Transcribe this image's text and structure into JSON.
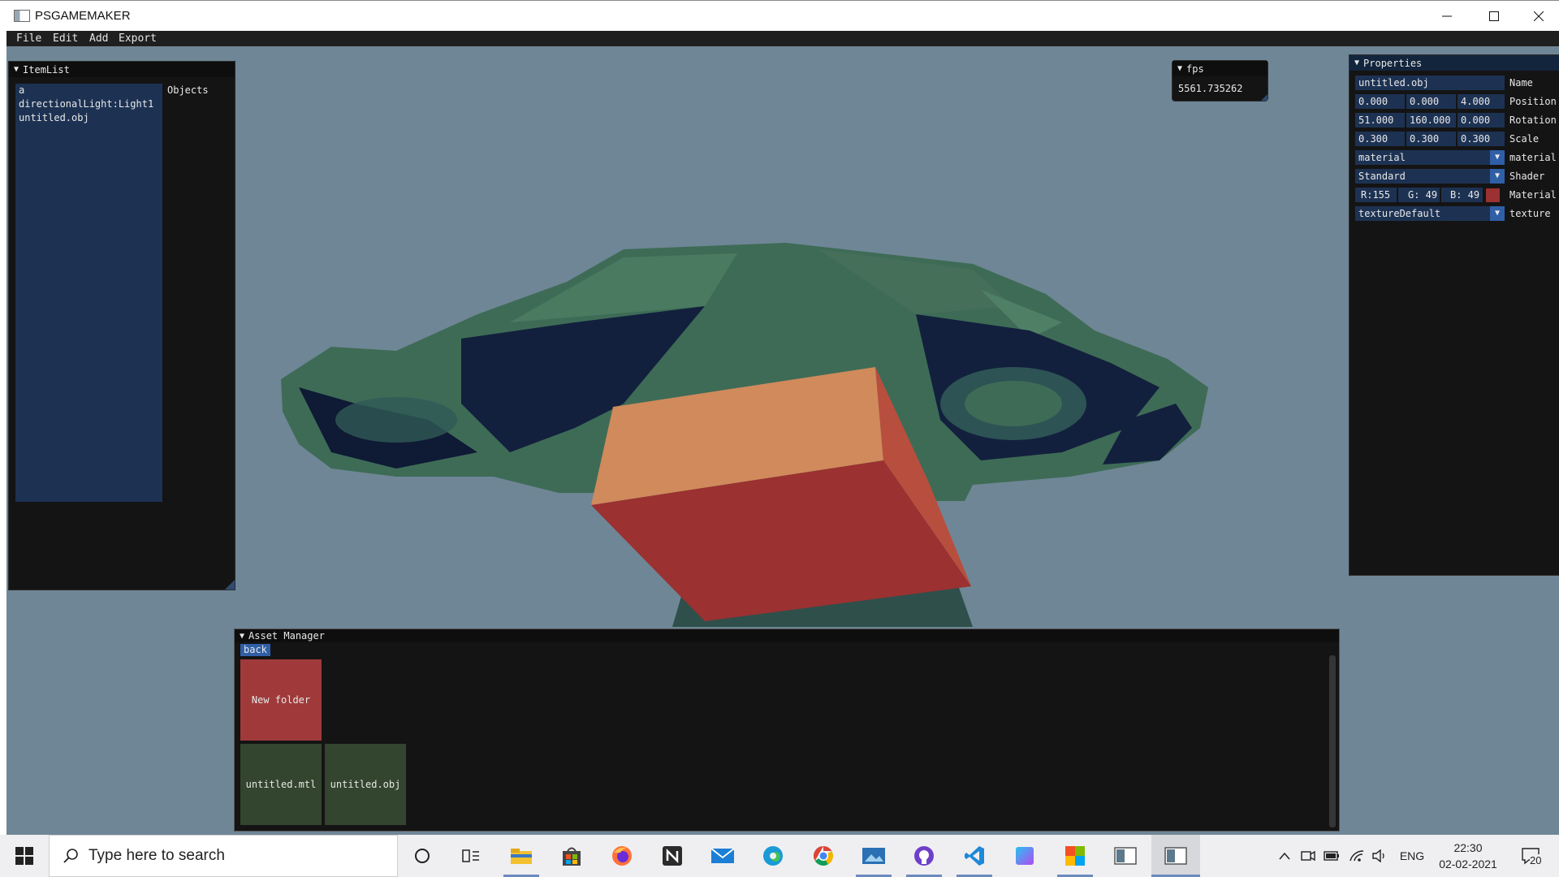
{
  "window": {
    "title": "PSGAMEMAKER",
    "controls": [
      "minimize-icon",
      "maximize-icon",
      "close-icon"
    ]
  },
  "menu": [
    "File",
    "Edit",
    "Add",
    "Export"
  ],
  "itemlist": {
    "title": "ItemList",
    "items": [
      "a",
      "directionalLight:Light1",
      "untitled.obj"
    ],
    "objects_label": "Objects"
  },
  "fps": {
    "title": "fps",
    "value": "5561.735262"
  },
  "properties": {
    "title": "Properties",
    "name": {
      "value": "untitled.obj",
      "label": "Name"
    },
    "position": {
      "values": [
        "0.000",
        "0.000",
        "4.000"
      ],
      "label": "Position"
    },
    "rotation": {
      "values": [
        "51.000",
        "160.000",
        "0.000"
      ],
      "label": "Rotation"
    },
    "scale": {
      "values": [
        "0.300",
        "0.300",
        "0.300"
      ],
      "label": "Scale"
    },
    "material_select": {
      "value": "material",
      "label": "material"
    },
    "shader_select": {
      "value": "Standard",
      "label": "Shader"
    },
    "color": {
      "r": "R:155",
      "g": "G: 49",
      "b": "B: 49",
      "label": "Material",
      "swatch": "#9b3131"
    },
    "texture_select": {
      "value": "textureDefault",
      "label": "texture"
    }
  },
  "assets": {
    "title": "Asset Manager",
    "back_label": "back",
    "items": [
      {
        "label": "New folder",
        "color": "#a03a3a"
      },
      {
        "label": "untitled.mtl",
        "color": "#33452e"
      },
      {
        "label": "untitled.obj",
        "color": "#33452e"
      }
    ]
  },
  "taskbar": {
    "search_placeholder": "Type here to search",
    "language": "ENG",
    "time": "22:30",
    "date": "02-02-2021",
    "notifications": "20"
  },
  "colors": {
    "viewport_bg": "#6f8696",
    "panel_bg": "#141414",
    "field_bg": "#1d3253",
    "accent": "#2f5fa6",
    "cube_front": "#9b3131",
    "cube_top": "#d08a5c",
    "cube_side": "#b84e3e",
    "model_green": "#3e6b56",
    "model_dark": "#12203d"
  }
}
